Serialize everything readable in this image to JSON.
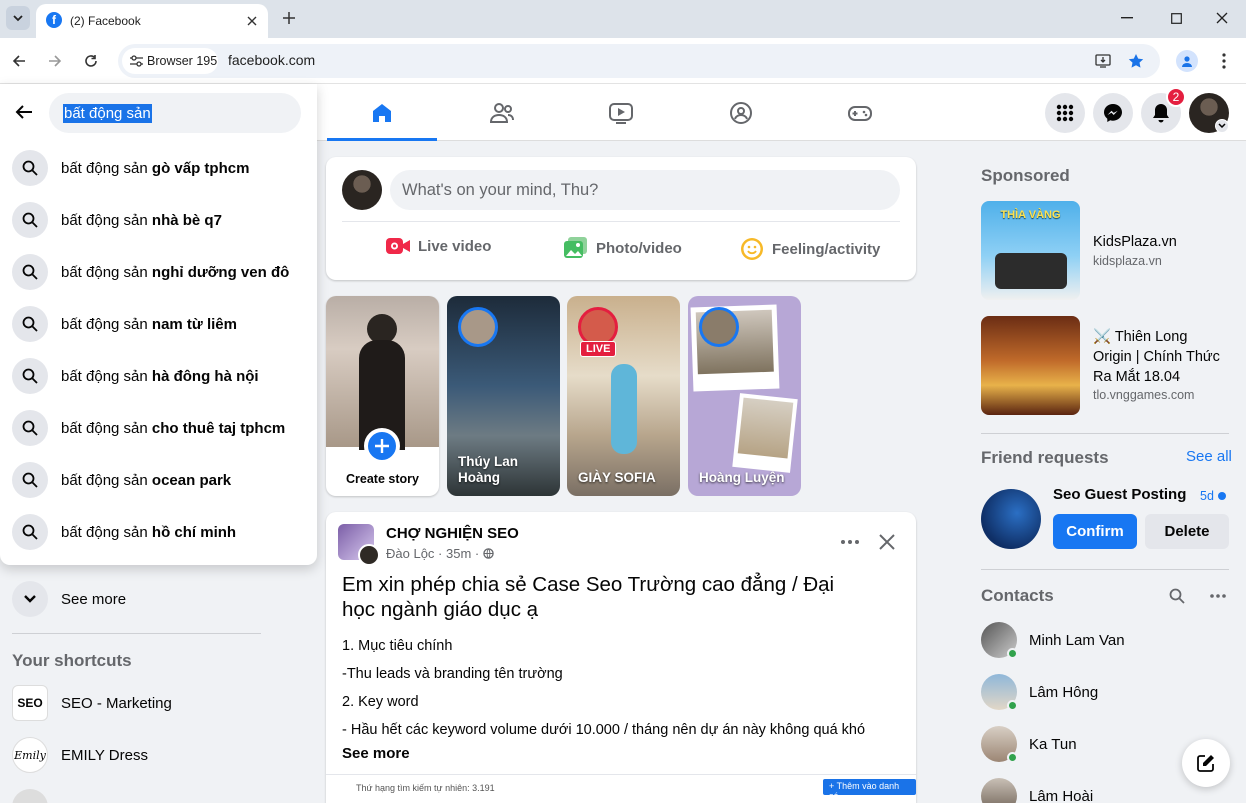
{
  "browser": {
    "tab_title": "(2) Facebook",
    "site_label": "Browser 195",
    "url": "facebook.com"
  },
  "search": {
    "query": "bất động sản",
    "suggestions": [
      {
        "prefix": "bất động sản ",
        "suffix": "gò vấp tphcm"
      },
      {
        "prefix": "bất động sản ",
        "suffix": "nhà bè q7"
      },
      {
        "prefix": "bất động sản ",
        "suffix": "nghỉ dưỡng ven đô"
      },
      {
        "prefix": "bất động sản ",
        "suffix": "nam từ liêm"
      },
      {
        "prefix": "bất động sản ",
        "suffix": "hà đông hà nội"
      },
      {
        "prefix": "bất động sản ",
        "suffix": "cho thuê taj tphcm"
      },
      {
        "prefix": "bất động sản ",
        "suffix": "ocean park"
      },
      {
        "prefix": "bất động sản ",
        "suffix": "hồ chí minh"
      }
    ]
  },
  "header": {
    "notification_count": "2"
  },
  "left": {
    "see_more": "See more",
    "shortcuts_title": "Your shortcuts",
    "shortcuts": [
      {
        "label": "SEO - Marketing",
        "avatar": "SEO"
      },
      {
        "label": "EMILY Dress",
        "avatar": "Emily"
      }
    ]
  },
  "composer": {
    "placeholder": "What's on your mind, Thu?",
    "live": "Live video",
    "photo": "Photo/video",
    "feeling": "Feeling/activity"
  },
  "stories": {
    "create": "Create story",
    "items": [
      {
        "name": "Thúy Lan Hoàng"
      },
      {
        "name": "GIÀY SOFIA",
        "badge": "LIVE"
      },
      {
        "name": "Hoàng Luyện"
      }
    ]
  },
  "post": {
    "group": "CHỢ NGHIỆN SEO",
    "author": "Đào Lộc",
    "time": "35m",
    "title": "Em xin phép chia sẻ Case Seo Trường cao đẳng / Đại học ngành giáo dục ạ",
    "lines": [
      "1. Mục tiêu chính",
      "-Thu leads và branding tên trường",
      "2. Key word",
      "- Hầu hết các keyword volume dưới 10.000 / tháng nên dự án này không quá khó"
    ],
    "see_more": "See more",
    "preview_text": "Thứ hạng tìm kiếm tự nhiên: 3.191",
    "preview_button": "+ Thêm vào danh sá"
  },
  "right": {
    "sponsored_title": "Sponsored",
    "ads": [
      {
        "title": "KidsPlaza.vn",
        "domain": "kidsplaza.vn",
        "image_text": "THÌA VÀNG"
      },
      {
        "title": "⚔️ Thiên Long Origin | Chính Thức Ra Mắt 18.04",
        "domain": "tlo.vnggames.com"
      }
    ],
    "friend_requests_title": "Friend requests",
    "see_all": "See all",
    "request": {
      "name": "Seo Guest Posting",
      "age": "5d",
      "confirm": "Confirm",
      "delete": "Delete"
    },
    "contacts_title": "Contacts",
    "contacts": [
      {
        "name": "Minh Lam Van"
      },
      {
        "name": "Lâm Hông"
      },
      {
        "name": "Ka Tun"
      },
      {
        "name": "Lâm Hoài"
      }
    ]
  },
  "colors": {
    "fb_blue": "#1877f2",
    "badge_red": "#e41e3f",
    "online_green": "#31a24c"
  }
}
